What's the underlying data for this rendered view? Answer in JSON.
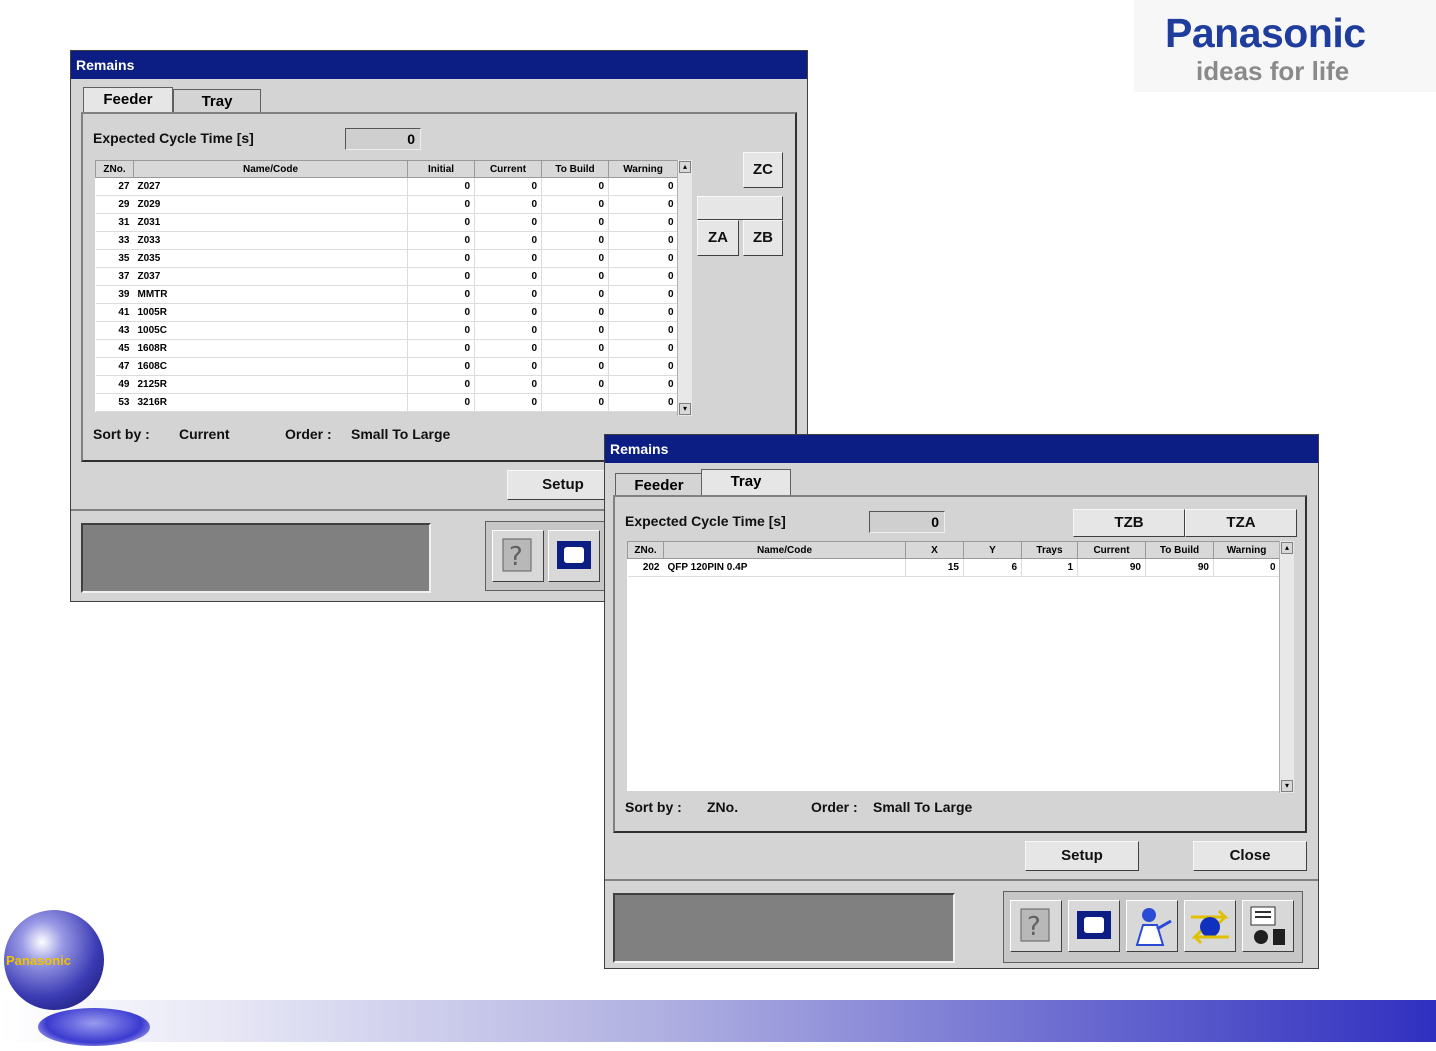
{
  "brand": {
    "name": "Panasonic",
    "slogan": "ideas for life",
    "globe_text": "Panasonic"
  },
  "feeder_window": {
    "title": "Remains",
    "tabs": [
      "Feeder",
      "Tray"
    ],
    "active_tab": "Feeder",
    "cycle_label": "Expected Cycle Time [s]",
    "cycle_value": "0",
    "columns": [
      "ZNo.",
      "Name/Code",
      "Initial",
      "Current",
      "To Build",
      "Warning"
    ],
    "rows": [
      [
        "27",
        "Z027",
        "0",
        "0",
        "0",
        "0"
      ],
      [
        "29",
        "Z029",
        "0",
        "0",
        "0",
        "0"
      ],
      [
        "31",
        "Z031",
        "0",
        "0",
        "0",
        "0"
      ],
      [
        "33",
        "Z033",
        "0",
        "0",
        "0",
        "0"
      ],
      [
        "35",
        "Z035",
        "0",
        "0",
        "0",
        "0"
      ],
      [
        "37",
        "Z037",
        "0",
        "0",
        "0",
        "0"
      ],
      [
        "39",
        "MMTR",
        "0",
        "0",
        "0",
        "0"
      ],
      [
        "41",
        "1005R",
        "0",
        "0",
        "0",
        "0"
      ],
      [
        "43",
        "1005C",
        "0",
        "0",
        "0",
        "0"
      ],
      [
        "45",
        "1608R",
        "0",
        "0",
        "0",
        "0"
      ],
      [
        "47",
        "1608C",
        "0",
        "0",
        "0",
        "0"
      ],
      [
        "49",
        "2125R",
        "0",
        "0",
        "0",
        "0"
      ],
      [
        "53",
        "3216R",
        "0",
        "0",
        "0",
        "0"
      ]
    ],
    "zone_buttons": {
      "zc": "ZC",
      "za": "ZA",
      "zb": "ZB"
    },
    "sort_label": "Sort by :",
    "sort_value": "Current",
    "order_label": "Order :",
    "order_value": "Small To Large",
    "setup_label": "Setup"
  },
  "tray_window": {
    "title": "Remains",
    "tabs": [
      "Feeder",
      "Tray"
    ],
    "active_tab": "Tray",
    "cycle_label": "Expected Cycle Time [s]",
    "cycle_value": "0",
    "zone_tabs": [
      "TZB",
      "TZA"
    ],
    "columns": [
      "ZNo.",
      "Name/Code",
      "X",
      "Y",
      "Trays",
      "Current",
      "To Build",
      "Warning"
    ],
    "rows": [
      [
        "202",
        "QFP 120PIN 0.4P",
        "15",
        "6",
        "1",
        "90",
        "90",
        "0"
      ]
    ],
    "sort_label": "Sort by :",
    "sort_value": "ZNo.",
    "order_label": "Order :",
    "order_value": "Small To Large",
    "setup_label": "Setup",
    "close_label": "Close"
  },
  "toolbar_icons": [
    "help-icon",
    "monitor-icon",
    "operator-icon",
    "transfer-icon",
    "production-icon"
  ]
}
